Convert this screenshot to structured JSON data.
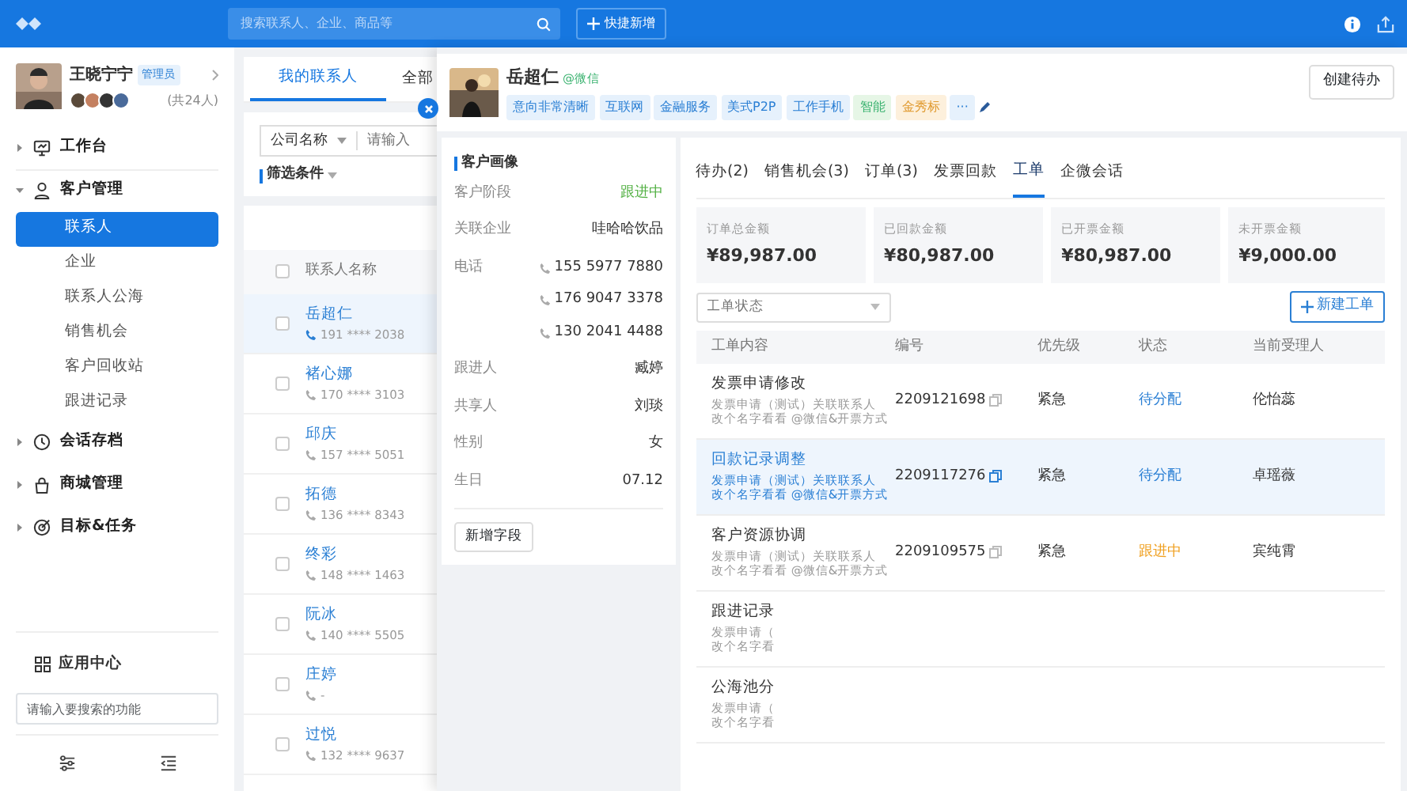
{
  "topbar": {
    "search": {
      "placeholder": "搜索联系人、企业、商品等"
    },
    "quick_add": "快捷新增"
  },
  "user": {
    "name": "王晓宁宁",
    "role": "管理员",
    "member_count": "(共24人)"
  },
  "sidebar": {
    "items": [
      {
        "label": "工作台",
        "expanded": false
      },
      {
        "label": "客户管理",
        "expanded": true,
        "children": [
          {
            "label": "联系人",
            "selected": true
          },
          {
            "label": "企业",
            "selected": false
          },
          {
            "label": "联系人公海",
            "selected": false
          },
          {
            "label": "销售机会",
            "selected": false
          },
          {
            "label": "客户回收站",
            "selected": false
          },
          {
            "label": "跟进记录",
            "selected": false
          }
        ]
      },
      {
        "label": "会话存档",
        "expanded": false
      },
      {
        "label": "商城管理",
        "expanded": false
      },
      {
        "label": "目标&任务",
        "expanded": false
      }
    ],
    "app_center": "应用中心",
    "search": {
      "placeholder": "请输入要搜索的功能"
    }
  },
  "contact_list": {
    "tabs": [
      {
        "label": "我的联系人",
        "selected": true
      },
      {
        "label": "全部",
        "selected": false
      }
    ],
    "filter": {
      "field": "公司名称",
      "placeholder": "请输入"
    },
    "conditions": "筛选条件",
    "column": "联系人名称",
    "all_checked": false,
    "rows": [
      {
        "name": "岳超仁",
        "phone": "191 **** 2038",
        "selected": true,
        "checked": false
      },
      {
        "name": "褚心娜",
        "phone": "170 **** 3103",
        "selected": false,
        "checked": false
      },
      {
        "name": "邱庆",
        "phone": "157 **** 5051",
        "selected": false,
        "checked": false
      },
      {
        "name": "拓德",
        "phone": "136 **** 8343",
        "selected": false,
        "checked": false
      },
      {
        "name": "终彩",
        "phone": "148 **** 1463",
        "selected": false,
        "checked": false
      },
      {
        "name": "阮冰",
        "phone": "140 **** 5505",
        "selected": false,
        "checked": false
      },
      {
        "name": "庄婷",
        "phone": "-",
        "selected": false,
        "checked": false
      },
      {
        "name": "过悦",
        "phone": "132 **** 9637",
        "selected": false,
        "checked": false
      }
    ]
  },
  "detail": {
    "name": "岳超仁",
    "source": "@微信",
    "tags": [
      {
        "label": "意向非常清晰",
        "color": "#e6f1fc"
      },
      {
        "label": "互联网",
        "color": "#e6f1fc"
      },
      {
        "label": "金融服务",
        "color": "#e6f1fc"
      },
      {
        "label": "美式P2P",
        "color": "#e6f1fc"
      },
      {
        "label": "工作手机",
        "color": "#e6f1fc"
      },
      {
        "label": "智能",
        "color": "#e6f6e6"
      },
      {
        "label": "金秀标",
        "color": "#fdf0dc"
      },
      {
        "label": "···",
        "color": "#e6f1fc"
      }
    ],
    "create_button": "创建待办",
    "profile": {
      "title": "客户画像",
      "fields": [
        {
          "kind": "status",
          "label": "客户阶段",
          "values": [
            "跟进中"
          ]
        },
        {
          "kind": "text",
          "label": "关联企业",
          "values": [
            "哇哈哈饮品"
          ]
        },
        {
          "kind": "phone",
          "label": "电话",
          "values": [
            "155 5977 7880",
            "176 9047 3378",
            "130 2041 4488"
          ]
        },
        {
          "kind": "text",
          "label": "跟进人",
          "values": [
            "臧婷"
          ]
        },
        {
          "kind": "text",
          "label": "共享人",
          "values": [
            "刘琰"
          ]
        },
        {
          "kind": "text",
          "label": "性别",
          "values": [
            "女"
          ]
        },
        {
          "kind": "text",
          "label": "生日",
          "values": [
            "07.12"
          ]
        }
      ],
      "add_field": "新增字段"
    },
    "tabs": [
      {
        "label": "待办(2)",
        "selected": false
      },
      {
        "label": "销售机会(3)",
        "selected": false
      },
      {
        "label": "订单(3)",
        "selected": false
      },
      {
        "label": "发票回款",
        "selected": false
      },
      {
        "label": "工单",
        "selected": true
      },
      {
        "label": "企微会话",
        "selected": false
      }
    ],
    "stats": [
      {
        "label": "订单总金额",
        "value": "¥89,987.00"
      },
      {
        "label": "已回款金额",
        "value": "¥80,987.00"
      },
      {
        "label": "已开票金额",
        "value": "¥80,987.00"
      },
      {
        "label": "未开票金额",
        "value": "¥9,000.00"
      }
    ],
    "status_filter": {
      "placeholder": "工单状态"
    },
    "new_button": "新建工单",
    "table": {
      "columns": [
        "工单内容",
        "编号",
        "优先级",
        "状态",
        "当前受理人"
      ],
      "rows": [
        {
          "title": "发票申请修改",
          "desc": [
            "发票申请（测试）关联联系人",
            "改个名字看看 @微信&开票方式"
          ],
          "number": "2209121698",
          "priority": "紧急",
          "status": "待分配",
          "color": "#2a7fd4",
          "assignee": "伦怡蕊",
          "selected": false
        },
        {
          "title": "回款记录调整",
          "desc": [
            "发票申请（测试）关联联系人",
            "改个名字看看 @微信&开票方式"
          ],
          "number": "2209117276",
          "priority": "紧急",
          "status": "待分配",
          "color": "#2a7fd4",
          "assignee": "卓瑶薇",
          "selected": true
        },
        {
          "title": "客户资源协调",
          "desc": [
            "发票申请（测试）关联联系人",
            "改个名字看看 @微信&开票方式"
          ],
          "number": "2209109575",
          "priority": "紧急",
          "status": "跟进中",
          "color": "#f0a020",
          "assignee": "宾纯霄",
          "selected": false
        },
        {
          "title": "跟进记录",
          "desc": [
            "发票申请（",
            "改个名字看"
          ],
          "selected": false
        },
        {
          "title": "公海池分",
          "desc": [
            "发票申请（",
            "改个名字看"
          ],
          "selected": false
        }
      ]
    }
  }
}
